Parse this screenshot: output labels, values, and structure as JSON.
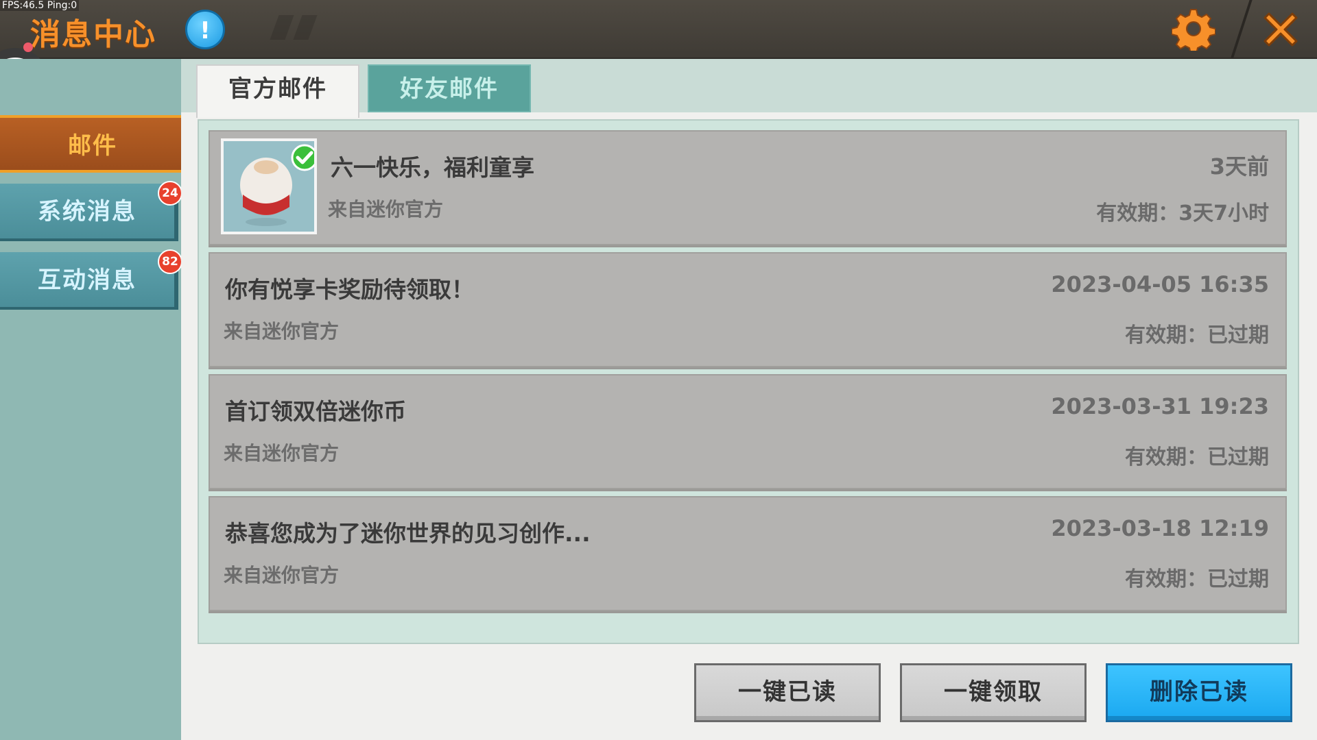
{
  "debug": {
    "fps_text": "FPS:46.5  Ping:0"
  },
  "header": {
    "title": "消息中心",
    "info_icon_glyph": "!"
  },
  "sidebar": {
    "items": [
      {
        "label": "邮件",
        "active": true
      },
      {
        "label": "系统消息",
        "badge": "24"
      },
      {
        "label": "互动消息",
        "badge": "82"
      }
    ]
  },
  "tabs": [
    {
      "label": "官方邮件",
      "active": true
    },
    {
      "label": "好友邮件",
      "active": false
    }
  ],
  "mails": [
    {
      "subject": "六一快乐，福利童享",
      "from": "来自迷你官方",
      "time": "3天前",
      "validity": "有效期：3天7小时",
      "has_thumbnail": true,
      "claimed": true
    },
    {
      "subject": "你有悦享卡奖励待领取！",
      "from": "来自迷你官方",
      "time": "2023-04-05 16:35",
      "validity": "有效期：已过期"
    },
    {
      "subject": "首订领双倍迷你币",
      "from": "来自迷你官方",
      "time": "2023-03-31 19:23",
      "validity": "有效期：已过期"
    },
    {
      "subject": "恭喜您成为了迷你世界的见习创作...",
      "from": "来自迷你官方",
      "time": "2023-03-18 12:19",
      "validity": "有效期：已过期"
    }
  ],
  "actions": {
    "read_all": "一键已读",
    "claim_all": "一键领取",
    "delete_read": "删除已读"
  },
  "colors": {
    "title": "#f7902a",
    "active_tab_bg": "#b86024",
    "badge": "#e8412d",
    "primary_button": "#1aa8f0"
  }
}
